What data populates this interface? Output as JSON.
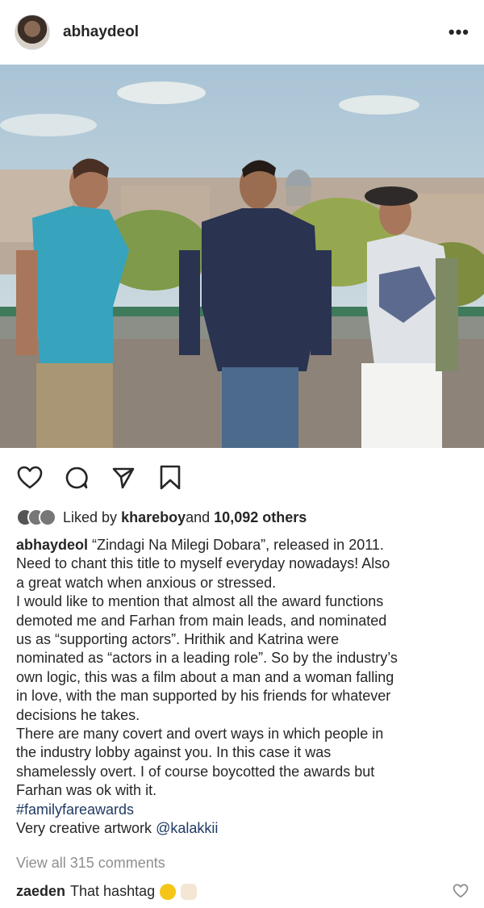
{
  "post": {
    "username": "abhaydeol",
    "more_label": "•••"
  },
  "icons": {
    "avatar": "profile-avatar",
    "more": "more-options-icon",
    "like": "heart-icon",
    "comment": "comment-bubble-icon",
    "share": "send-icon",
    "save": "bookmark-icon"
  },
  "likes": {
    "prefix": "Liked by ",
    "user": "khareboy",
    "middle": " and ",
    "count": "10,092 others"
  },
  "caption": {
    "user": "abhaydeol",
    "lines": [
      "“Zindagi Na Milegi Dobara”, released in 2011.",
      "Need to chant this title to myself everyday nowadays! Also",
      "a great watch when anxious or stressed.",
      "I would like to mention that almost all the award functions",
      "demoted me and Farhan from main leads, and nominated",
      "us as “supporting actors”. Hrithik and Katrina were",
      "nominated as “actors in a leading role”. So by the industry’s",
      "own logic, this was a film about a man and a woman falling",
      "in love, with the man supported by his friends for whatever",
      "decisions he takes.",
      "There are many covert and overt ways in which people in",
      "the industry lobby against you. In this case it was",
      "shamelessly overt. I of course boycotted the awards but",
      "Farhan was ok with it."
    ],
    "hashtag": "#familyfareawards",
    "artwork_prefix": "Very creative artwork ",
    "artwork_mention": "@kalakkii"
  },
  "comments": {
    "view_all": "View all 315 comments",
    "top_user": "zaeden",
    "top_text": "That hashtag"
  },
  "colors": {
    "text": "#262626",
    "muted": "#8e8e8e",
    "link": "#1f3a63"
  }
}
